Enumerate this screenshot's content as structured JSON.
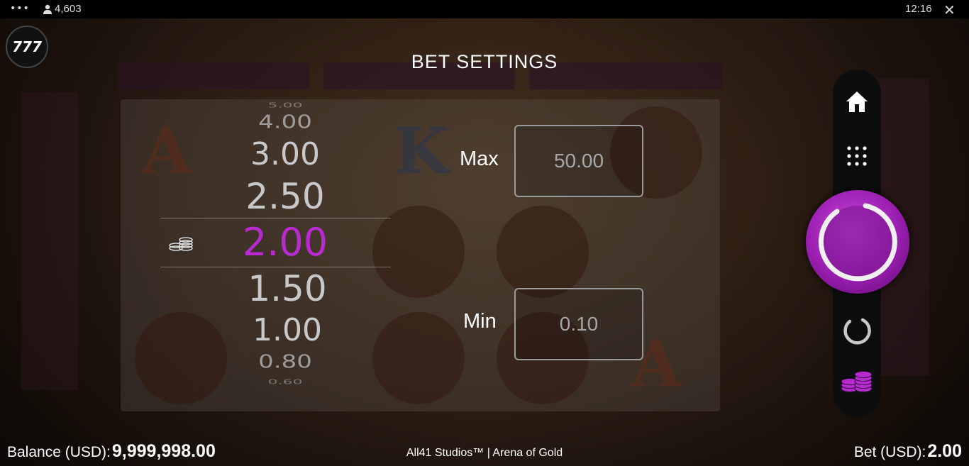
{
  "status_bar": {
    "menu_dots": "•••",
    "player_count": "4,603",
    "time": "12:16",
    "close_glyph": "✕"
  },
  "logo": {
    "text": "777"
  },
  "bet_settings": {
    "title": "BET SETTINGS",
    "values": [
      "5.00",
      "4.00",
      "3.00",
      "2.50",
      "2.00",
      "1.50",
      "1.00",
      "0.80",
      "0.60"
    ],
    "selected": "2.00",
    "max_label": "Max",
    "max_value": "50.00",
    "min_label": "Min",
    "min_value": "0.10"
  },
  "rail": {
    "home_icon": "home-icon",
    "menu_icon": "grid-dots-icon",
    "spin_icon": "spin-icon",
    "autoplay_icon": "autoplay-icon",
    "bet_icon": "coins-icon"
  },
  "footer": {
    "balance_label": "Balance (USD):",
    "balance_value": "9,999,998.00",
    "studio": "All41 Studios™ | Arena of Gold",
    "bet_label": "Bet (USD):",
    "bet_value": "2.00"
  },
  "colors": {
    "accent": "#b62ad0",
    "box_border": "#9a9a9a"
  }
}
